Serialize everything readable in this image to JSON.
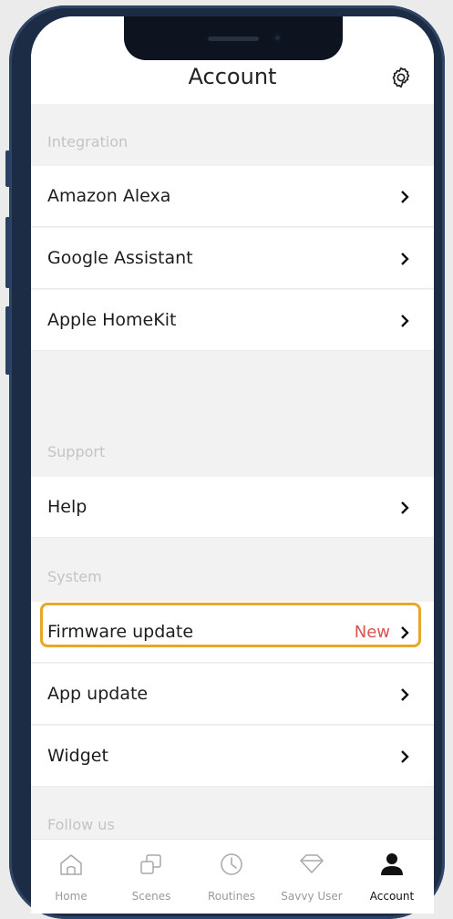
{
  "header": {
    "title": "Account",
    "settings_icon": "gear-icon"
  },
  "sections": {
    "integration": "Integration",
    "support": "Support",
    "system": "System",
    "follow_us": "Follow us"
  },
  "rows": {
    "amazon_alexa": "Amazon Alexa",
    "google_assistant": "Google Assistant",
    "apple_homekit": "Apple HomeKit",
    "help": "Help",
    "firmware_update": "Firmware update",
    "firmware_badge": "New",
    "app_update": "App update",
    "widget": "Widget"
  },
  "tabs": [
    {
      "label": "Home",
      "icon": "home-icon",
      "active": false
    },
    {
      "label": "Scenes",
      "icon": "scenes-icon",
      "active": false
    },
    {
      "label": "Routines",
      "icon": "clock-icon",
      "active": false
    },
    {
      "label": "Savvy User",
      "icon": "diamond-icon",
      "active": false
    },
    {
      "label": "Account",
      "icon": "user-icon",
      "active": true
    }
  ],
  "colors": {
    "badge": "#d9534f",
    "highlight": "#e6a72a",
    "frame": "#1c2c45"
  }
}
